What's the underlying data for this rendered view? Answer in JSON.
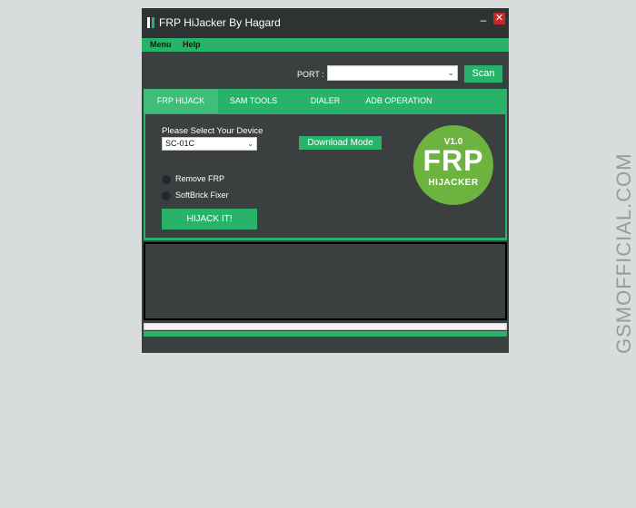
{
  "window": {
    "title": "FRP HiJacker By Hagard",
    "minimize_symbol": "–",
    "close_symbol": "✕"
  },
  "menu": {
    "items": [
      "Menu",
      "Help"
    ]
  },
  "port": {
    "label": "PORT :",
    "value": "",
    "scan_label": "Scan"
  },
  "tabs": [
    {
      "label": "FRP HIJACK",
      "active": true
    },
    {
      "label": "SAM TOOLS",
      "active": false
    },
    {
      "label": "DIALER",
      "active": false
    },
    {
      "label": "ADB OPERATION",
      "active": false
    }
  ],
  "frp_hijack": {
    "device_label": "Please Select Your Device",
    "device_value": "SC-01C",
    "download_mode_label": "Download Mode",
    "options": [
      "Remove FRP",
      "SoftBrick Fixer"
    ],
    "hijack_label": "HIJACK IT!",
    "badge": {
      "version": "V1.0",
      "big": "FRP",
      "small": "HIJACKER"
    }
  },
  "log": {
    "text": ""
  },
  "watermark": "GSMOFFICIAL.COM",
  "colors": {
    "accent": "#29b36a",
    "window_bg": "#3b3f40",
    "titlebar_bg": "#2e3233",
    "close": "#c62828",
    "badge": "#6cb33f"
  }
}
